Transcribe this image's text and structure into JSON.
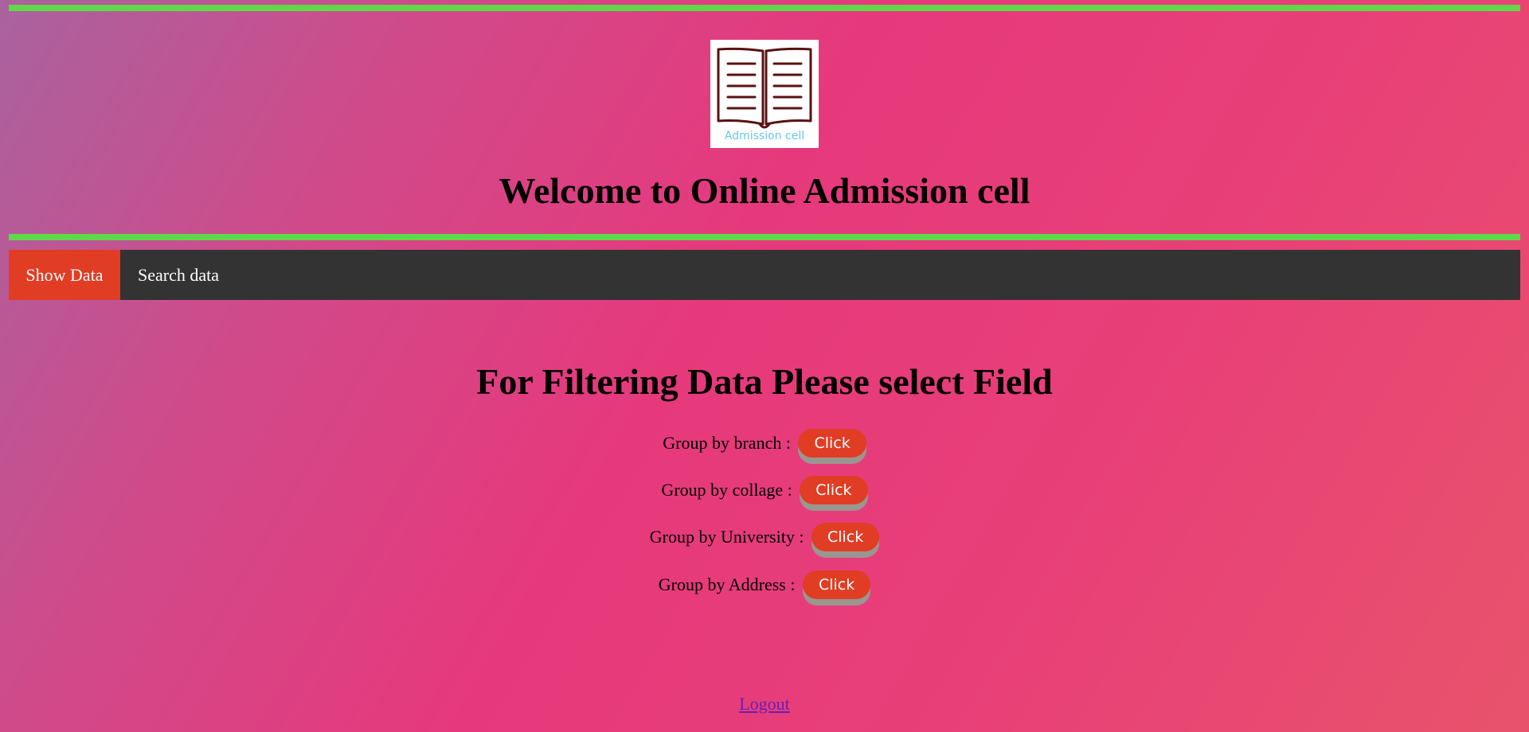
{
  "header": {
    "logo_caption": "Admission cell",
    "title": "Welcome to Online Admission cell"
  },
  "nav": {
    "items": [
      {
        "label": "Show Data",
        "active": true
      },
      {
        "label": "Search data",
        "active": false
      }
    ]
  },
  "filter": {
    "heading": "For Filtering Data Please select Field",
    "rows": [
      {
        "label": "Group by branch :",
        "button": "Click"
      },
      {
        "label": "Group by collage :",
        "button": "Click"
      },
      {
        "label": "Group by University :",
        "button": "Click"
      },
      {
        "label": "Group by Address :",
        "button": "Click"
      }
    ]
  },
  "footer": {
    "logout": "Logout"
  },
  "colors": {
    "accent_bar": "#5fd84a",
    "navbar_bg": "#333333",
    "active_nav": "#e03d24",
    "button": "#e03d24",
    "button_shadow": "#9a9690",
    "logo_lines": "#5a1212",
    "logo_caption": "#67c8e6"
  },
  "icons": {
    "logo": "open-book-icon"
  }
}
